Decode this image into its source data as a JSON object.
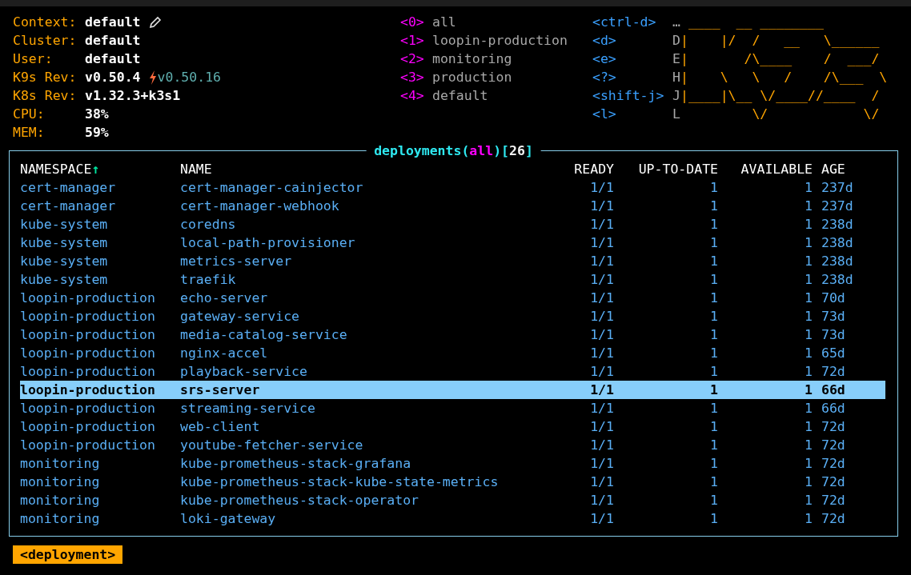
{
  "info": [
    {
      "label": "Context:",
      "value": "default"
    },
    {
      "label": "Cluster:",
      "value": "default"
    },
    {
      "label": "User:",
      "value": "default"
    },
    {
      "label": "K9s Rev:",
      "value": "v0.50.4",
      "update": "v0.50.16"
    },
    {
      "label": "K8s Rev:",
      "value": "v1.32.3+k3s1"
    },
    {
      "label": "CPU:",
      "value": "38%"
    },
    {
      "label": "MEM:",
      "value": "59%"
    }
  ],
  "namespaces": [
    {
      "key": "<0>",
      "name": "all"
    },
    {
      "key": "<1>",
      "name": "loopin-production"
    },
    {
      "key": "<2>",
      "name": "monitoring"
    },
    {
      "key": "<3>",
      "name": "production"
    },
    {
      "key": "<4>",
      "name": "default"
    }
  ],
  "key_hints": [
    {
      "key": "<ctrl-d>",
      "description": "…"
    },
    {
      "key": "<d>",
      "description": "D"
    },
    {
      "key": "<e>",
      "description": "E"
    },
    {
      "key": "<?>",
      "description": "H"
    },
    {
      "key": "<shift-j>",
      "description": "J"
    },
    {
      "key": "<l>",
      "description": "L"
    }
  ],
  "logo": [
    " ____  __ ________",
    "|    |/  /   __   \\______",
    "|       /\\____    /  ___/",
    "|    \\   \\   /    /\\___  \\",
    "|____|\\__ \\/____//____  /",
    "         \\/            \\/"
  ],
  "table": {
    "title": [
      {
        "kind": "resource",
        "text": "deployments"
      },
      {
        "kind": "bracket",
        "text": "("
      },
      {
        "kind": "namespace",
        "text": "all"
      },
      {
        "kind": "bracket",
        "text": ")["
      },
      {
        "kind": "count",
        "text": "26"
      },
      {
        "kind": "bracket",
        "text": "]"
      }
    ],
    "columns": [
      {
        "label": "NAMESPACE",
        "sort": "↑"
      },
      {
        "label": "NAME"
      },
      {
        "label": "READY"
      },
      {
        "label": "UP-TO-DATE"
      },
      {
        "label": "AVAILABLE"
      },
      {
        "label": "AGE"
      }
    ],
    "rows": [
      {
        "cells": [
          "cert-manager",
          "cert-manager-cainjector",
          "1/1",
          "1",
          "1",
          "237d"
        ],
        "selected": false
      },
      {
        "cells": [
          "cert-manager",
          "cert-manager-webhook",
          "1/1",
          "1",
          "1",
          "237d"
        ],
        "selected": false
      },
      {
        "cells": [
          "kube-system",
          "coredns",
          "1/1",
          "1",
          "1",
          "238d"
        ],
        "selected": false
      },
      {
        "cells": [
          "kube-system",
          "local-path-provisioner",
          "1/1",
          "1",
          "1",
          "238d"
        ],
        "selected": false
      },
      {
        "cells": [
          "kube-system",
          "metrics-server",
          "1/1",
          "1",
          "1",
          "238d"
        ],
        "selected": false
      },
      {
        "cells": [
          "kube-system",
          "traefik",
          "1/1",
          "1",
          "1",
          "238d"
        ],
        "selected": false
      },
      {
        "cells": [
          "loopin-production",
          "echo-server",
          "1/1",
          "1",
          "1",
          "70d"
        ],
        "selected": false
      },
      {
        "cells": [
          "loopin-production",
          "gateway-service",
          "1/1",
          "1",
          "1",
          "73d"
        ],
        "selected": false
      },
      {
        "cells": [
          "loopin-production",
          "media-catalog-service",
          "1/1",
          "1",
          "1",
          "73d"
        ],
        "selected": false
      },
      {
        "cells": [
          "loopin-production",
          "nginx-accel",
          "1/1",
          "1",
          "1",
          "65d"
        ],
        "selected": false
      },
      {
        "cells": [
          "loopin-production",
          "playback-service",
          "1/1",
          "1",
          "1",
          "72d"
        ],
        "selected": false
      },
      {
        "cells": [
          "loopin-production",
          "srs-server",
          "1/1",
          "1",
          "1",
          "66d"
        ],
        "selected": true
      },
      {
        "cells": [
          "loopin-production",
          "streaming-service",
          "1/1",
          "1",
          "1",
          "66d"
        ],
        "selected": false
      },
      {
        "cells": [
          "loopin-production",
          "web-client",
          "1/1",
          "1",
          "1",
          "72d"
        ],
        "selected": false
      },
      {
        "cells": [
          "loopin-production",
          "youtube-fetcher-service",
          "1/1",
          "1",
          "1",
          "72d"
        ],
        "selected": false
      },
      {
        "cells": [
          "monitoring",
          "kube-prometheus-stack-grafana",
          "1/1",
          "1",
          "1",
          "72d"
        ],
        "selected": false
      },
      {
        "cells": [
          "monitoring",
          "kube-prometheus-stack-kube-state-metrics",
          "1/1",
          "1",
          "1",
          "72d"
        ],
        "selected": false
      },
      {
        "cells": [
          "monitoring",
          "kube-prometheus-stack-operator",
          "1/1",
          "1",
          "1",
          "72d"
        ],
        "selected": false
      },
      {
        "cells": [
          "monitoring",
          "loki-gateway",
          "1/1",
          "1",
          "1",
          "72d"
        ],
        "selected": false
      }
    ]
  },
  "breadcrumb": "<deployment>"
}
